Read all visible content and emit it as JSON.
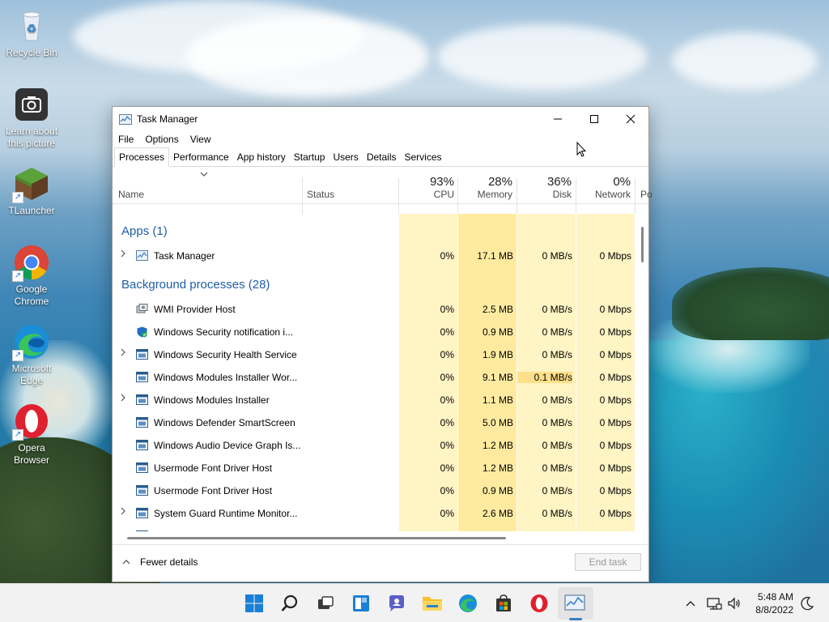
{
  "desktop": {
    "icons": [
      {
        "label": "Recycle Bin"
      },
      {
        "label": "Learn about this picture"
      },
      {
        "label": "TLauncher"
      },
      {
        "label": "Google Chrome"
      },
      {
        "label": "Microsoft Edge"
      },
      {
        "label": "Opera Browser"
      }
    ]
  },
  "window": {
    "title": "Task Manager",
    "menu": [
      "File",
      "Options",
      "View"
    ],
    "tabs": [
      "Processes",
      "Performance",
      "App history",
      "Startup",
      "Users",
      "Details",
      "Services"
    ],
    "active_tab": "Processes",
    "columns": {
      "name": "Name",
      "status": "Status",
      "cpu": {
        "pct": "93%",
        "label": "CPU"
      },
      "memory": {
        "pct": "28%",
        "label": "Memory"
      },
      "disk": {
        "pct": "36%",
        "label": "Disk"
      },
      "network": {
        "pct": "0%",
        "label": "Network"
      },
      "power_partial": "Po"
    },
    "groups": {
      "apps": "Apps (1)",
      "background": "Background processes (28)"
    },
    "apps": [
      {
        "name": "Task Manager",
        "cpu": "0%",
        "memory": "17.1 MB",
        "disk": "0 MB/s",
        "network": "0 Mbps",
        "expandable": true
      }
    ],
    "background": [
      {
        "name": "WMI Provider Host",
        "cpu": "0%",
        "memory": "2.5 MB",
        "disk": "0 MB/s",
        "network": "0 Mbps",
        "expandable": false,
        "icon": "wmi-icon"
      },
      {
        "name": "Windows Security notification i...",
        "cpu": "0%",
        "memory": "0.9 MB",
        "disk": "0 MB/s",
        "network": "0 Mbps",
        "expandable": false,
        "icon": "security-shield-icon"
      },
      {
        "name": "Windows Security Health Service",
        "cpu": "0%",
        "memory": "1.9 MB",
        "disk": "0 MB/s",
        "network": "0 Mbps",
        "expandable": true,
        "icon": "service-window-icon"
      },
      {
        "name": "Windows Modules Installer Wor...",
        "cpu": "0%",
        "memory": "9.1 MB",
        "disk": "0.1 MB/s",
        "network": "0 Mbps",
        "expandable": false,
        "icon": "service-window-icon"
      },
      {
        "name": "Windows Modules Installer",
        "cpu": "0%",
        "memory": "1.1 MB",
        "disk": "0 MB/s",
        "network": "0 Mbps",
        "expandable": true,
        "icon": "service-window-icon"
      },
      {
        "name": "Windows Defender SmartScreen",
        "cpu": "0%",
        "memory": "5.0 MB",
        "disk": "0 MB/s",
        "network": "0 Mbps",
        "expandable": false,
        "icon": "service-window-icon"
      },
      {
        "name": "Windows Audio Device Graph Is...",
        "cpu": "0%",
        "memory": "1.2 MB",
        "disk": "0 MB/s",
        "network": "0 Mbps",
        "expandable": false,
        "icon": "service-window-icon"
      },
      {
        "name": "Usermode Font Driver Host",
        "cpu": "0%",
        "memory": "1.2 MB",
        "disk": "0 MB/s",
        "network": "0 Mbps",
        "expandable": false,
        "icon": "service-window-icon"
      },
      {
        "name": "Usermode Font Driver Host",
        "cpu": "0%",
        "memory": "0.9 MB",
        "disk": "0 MB/s",
        "network": "0 Mbps",
        "expandable": false,
        "icon": "service-window-icon"
      },
      {
        "name": "System Guard Runtime Monitor...",
        "cpu": "0%",
        "memory": "2.6 MB",
        "disk": "0 MB/s",
        "network": "0 Mbps",
        "expandable": true,
        "icon": "service-window-icon"
      }
    ],
    "footer": {
      "fewer_details": "Fewer details",
      "end_task": "End task"
    }
  },
  "taskbar": {
    "clock_time": "5:48 AM",
    "clock_date": "8/8/2022"
  },
  "colors": {
    "group_text": "#1f5ea8",
    "heat_light": "#fff4c4",
    "heat_medium": "#ffeaa0",
    "taskbar_bg": "#f2f2f2"
  }
}
